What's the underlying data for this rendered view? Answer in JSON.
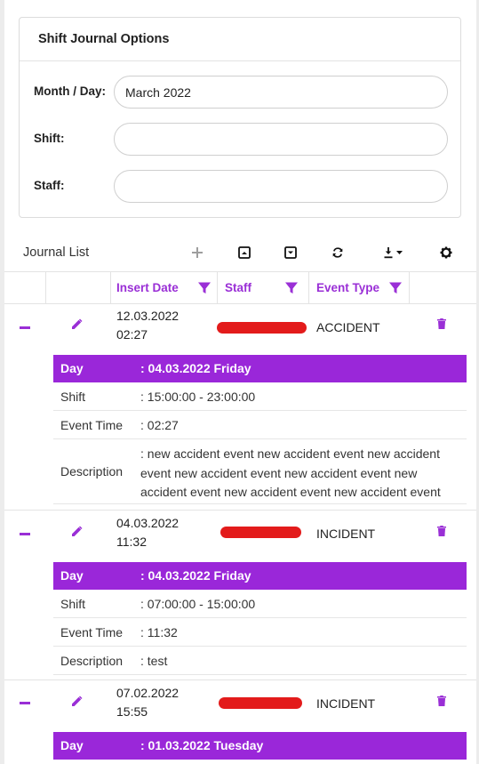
{
  "options": {
    "title": "Shift Journal Options",
    "month_day_label": "Month / Day:",
    "month_day_value": "March 2022",
    "shift_label": "Shift:",
    "shift_value": "",
    "staff_label": "Staff:",
    "staff_value": ""
  },
  "list": {
    "title": "Journal List",
    "toolbar_icons": [
      "plus-icon",
      "expand-all-icon",
      "collapse-all-icon",
      "refresh-icon",
      "download-icon",
      "settings-icon"
    ]
  },
  "columns": {
    "insert_date": "Insert Date",
    "staff": "Staff",
    "event_type": "Event Type"
  },
  "colors": {
    "accent": "#9a27d9",
    "redaction": "#e31b1b"
  },
  "rows": [
    {
      "date": "12.03.2022",
      "time": "02:27",
      "event_type": "ACCIDENT",
      "details": {
        "day_key": "Day",
        "day_value": ": 04.03.2022 Friday",
        "shift_key": "Shift",
        "shift_value": ": 15:00:00 - 23:00:00",
        "event_time_key": "Event Time",
        "event_time_value": ": 02:27",
        "description_key": "Description",
        "description_value": ": new accident event new accident event new accident event new accident event new accident event new accident event new accident event new accident event"
      }
    },
    {
      "date": "04.03.2022",
      "time": "11:32",
      "event_type": "INCIDENT",
      "details": {
        "day_key": "Day",
        "day_value": ": 04.03.2022 Friday",
        "shift_key": "Shift",
        "shift_value": ": 07:00:00 - 15:00:00",
        "event_time_key": "Event Time",
        "event_time_value": ": 11:32",
        "description_key": "Description",
        "description_value": ": test"
      }
    },
    {
      "date": "07.02.2022",
      "time": "15:55",
      "event_type": "INCIDENT",
      "details": {
        "day_key": "Day",
        "day_value": ": 01.03.2022 Tuesday"
      }
    }
  ]
}
